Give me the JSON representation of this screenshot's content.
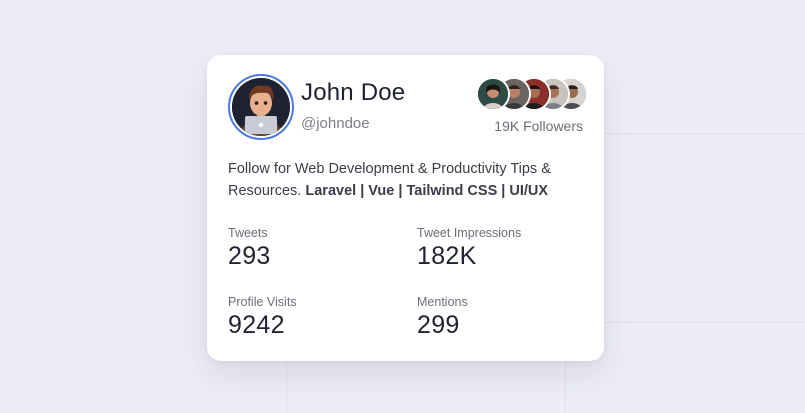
{
  "profile": {
    "name": "John Doe",
    "handle": "@johndoe",
    "followers_label": "19K Followers"
  },
  "bio": {
    "text": "Follow for Web Development & Productivity Tips & Resources. ",
    "tags": [
      "Laravel",
      "Vue",
      "Tailwind CSS",
      "UI/UX"
    ],
    "separator": " | "
  },
  "stats": [
    {
      "label": "Tweets",
      "value": "293"
    },
    {
      "label": "Tweet Impressions",
      "value": "182K"
    },
    {
      "label": "Profile Visits",
      "value": "9242"
    },
    {
      "label": "Mentions",
      "value": "299"
    }
  ],
  "colors": {
    "background": "#ecedf6",
    "card": "#ffffff",
    "avatar_ring": "#4a78e6",
    "text_primary": "#1f2230",
    "text_muted": "#6b6e78"
  },
  "icons": {
    "avatar": "memoji-with-laptop",
    "followers": [
      "follower-avatar-1",
      "follower-avatar-2",
      "follower-avatar-3",
      "follower-avatar-4",
      "follower-avatar-5"
    ]
  }
}
